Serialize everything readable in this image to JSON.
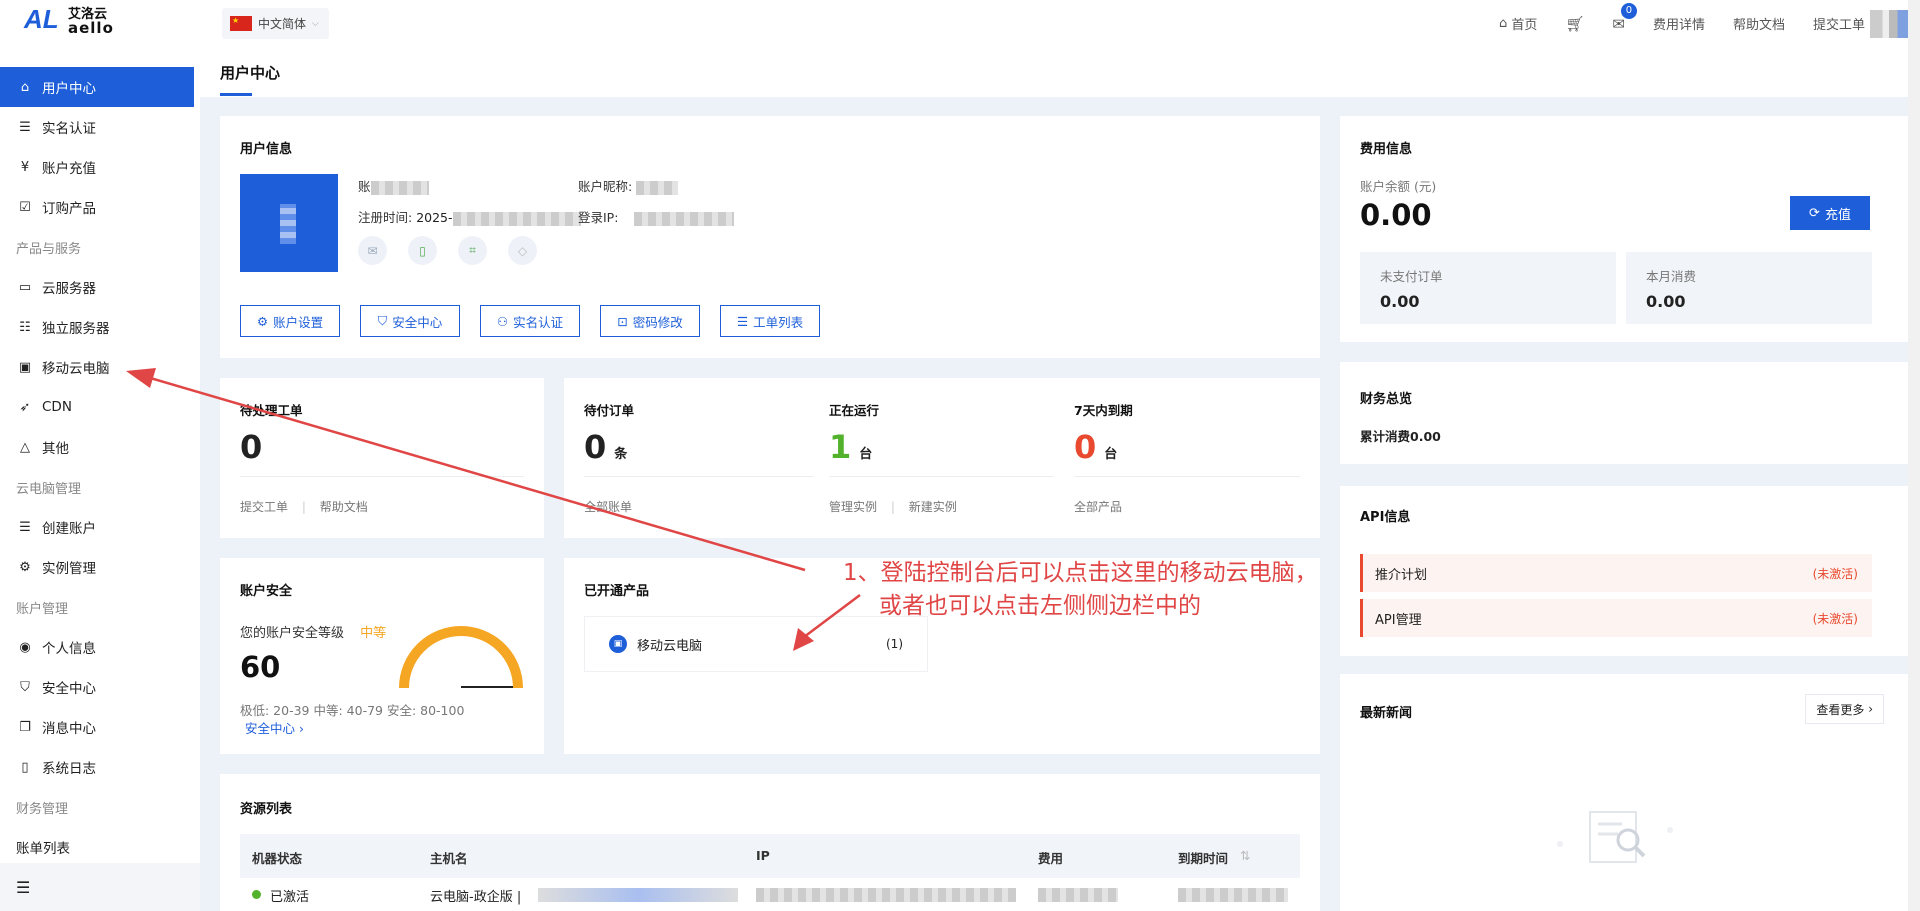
{
  "app": {
    "logo_cn": "艾洛云",
    "logo_en": "aello",
    "logo_mark": "AL"
  },
  "topbar": {
    "language": "中文简体",
    "nav": [
      "首页",
      "费用详情",
      "帮助文档",
      "提交工单"
    ],
    "message_count": "0"
  },
  "sidebar": {
    "items": [
      {
        "label": "用户中心",
        "icon": "home-icon",
        "active": true
      },
      {
        "label": "实名认证",
        "icon": "id-card-icon"
      },
      {
        "label": "账户充值",
        "icon": "yuan-icon"
      },
      {
        "label": "订购产品",
        "icon": "check-box-icon"
      },
      {
        "header": "产品与服务"
      },
      {
        "label": "云服务器",
        "icon": "server-icon"
      },
      {
        "label": "独立服务器",
        "icon": "rack-icon"
      },
      {
        "label": "移动云电脑",
        "icon": "monitor-icon"
      },
      {
        "label": "CDN",
        "icon": "rocket-icon"
      },
      {
        "label": "其他",
        "icon": "triangle-icon"
      },
      {
        "header": "云电脑管理"
      },
      {
        "label": "创建账户",
        "icon": "id-card-icon"
      },
      {
        "label": "实例管理",
        "icon": "gear-icon"
      },
      {
        "header": "账户管理"
      },
      {
        "label": "个人信息",
        "icon": "user-circle-icon"
      },
      {
        "label": "安全中心",
        "icon": "shield-icon"
      },
      {
        "label": "消息中心",
        "icon": "message-icon"
      },
      {
        "label": "系统日志",
        "icon": "file-icon"
      },
      {
        "header": "财务管理"
      },
      {
        "label": "账单列表",
        "icon": ""
      }
    ],
    "collapse_icon": "menu-collapse-icon"
  },
  "page": {
    "title": "用户中心"
  },
  "user_info": {
    "title": "用户信息",
    "account_label": "账",
    "nickname_label": "账户昵称:",
    "register_label": "注册时间:",
    "register_value": "2025-",
    "login_ip_label": "登录IP:",
    "buttons": [
      "账户设置",
      "安全中心",
      "实名认证",
      "密码修改",
      "工单列表"
    ]
  },
  "fee_info": {
    "title": "费用信息",
    "balance_label": "账户余额 (元)",
    "balance": "0.00",
    "recharge": "充值",
    "unpaid_label": "未支付订单",
    "unpaid": "0.00",
    "month_label": "本月消费",
    "month": "0.00"
  },
  "stats": {
    "pending_ticket": {
      "label": "待处理工单",
      "value": "0",
      "links": [
        "提交工单",
        "帮助文档"
      ]
    },
    "pending_order": {
      "label": "待付订单",
      "value": "0",
      "unit": "条",
      "link": "全部账单"
    },
    "running": {
      "label": "正在运行",
      "value": "1",
      "unit": "台",
      "links": [
        "管理实例",
        "新建实例"
      ]
    },
    "expiring": {
      "label": "7天内到期",
      "value": "0",
      "unit": "台",
      "link": "全部产品"
    }
  },
  "finance": {
    "title": "财务总览",
    "total": "累计消费0.00"
  },
  "security": {
    "title": "账户安全",
    "level_label": "您的账户安全等级",
    "level": "中等",
    "score": "60",
    "legend": "极低: 20-39 中等: 40-79 安全: 80-100",
    "link": "安全中心"
  },
  "products": {
    "title": "已开通产品",
    "item": "移动云电脑",
    "count": "(1)"
  },
  "api": {
    "title": "API信息",
    "rows": [
      {
        "label": "推介计划",
        "status": "(未激活)"
      },
      {
        "label": "API管理",
        "status": "(未激活)"
      }
    ]
  },
  "news": {
    "title": "最新新闻",
    "more": "查看更多"
  },
  "resources": {
    "title": "资源列表",
    "columns": [
      "机器状态",
      "主机名",
      "IP",
      "费用",
      "到期时间"
    ],
    "row": {
      "status": "已激活",
      "hostname": "云电脑-政企版 |"
    }
  },
  "annotation": {
    "line1": "1、登陆控制台后可以点击这里的移动云电脑，",
    "line2": "或者也可以点击左侧侧边栏中的"
  },
  "colors": {
    "accent": "#1e5fd9",
    "warning": "#f5a623",
    "danger": "#e8492f",
    "running": "#52b22c"
  }
}
